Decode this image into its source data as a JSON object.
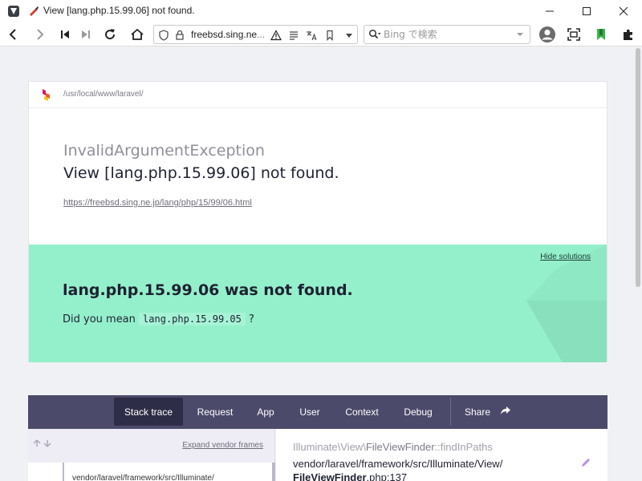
{
  "browser": {
    "window_title": "View [lang.php.15.99.06] not found.",
    "url_host": "freebsd.sing.ne",
    "url_rest": "...",
    "search_placeholder": "Bing で検索",
    "accent_color": "#3bb54a"
  },
  "error": {
    "path": "/usr/local/www/laravel/",
    "exception_class": "InvalidArgumentException",
    "message": "View [lang.php.15.99.06] not found.",
    "url": "https://freebsd.sing.ne.jp/lang/php/15/99/06.html"
  },
  "solution": {
    "hide_label": "Hide solutions",
    "title": "lang.php.15.99.06 was not found.",
    "suggestion_prefix": "Did you mean",
    "suggestion_code": "lang.php.15.99.05",
    "suggestion_suffix": "?"
  },
  "tabs": [
    {
      "label": "Stack trace"
    },
    {
      "label": "Request"
    },
    {
      "label": "App"
    },
    {
      "label": "User"
    },
    {
      "label": "Context"
    },
    {
      "label": "Debug"
    },
    {
      "label": "Share"
    }
  ],
  "trace": {
    "expand_label": "Expand vendor frames",
    "frame_path": "vendor/laravel/framework/src/Illuminate/",
    "class_prefix": "Illuminate\\View\\",
    "class_name": "FileViewFinder",
    "method": "::findInPaths",
    "file_line1": "vendor/laravel/framework/src/Illuminate/View/",
    "file_name": "FileViewFinder",
    "file_ext_line": ".php:137"
  }
}
